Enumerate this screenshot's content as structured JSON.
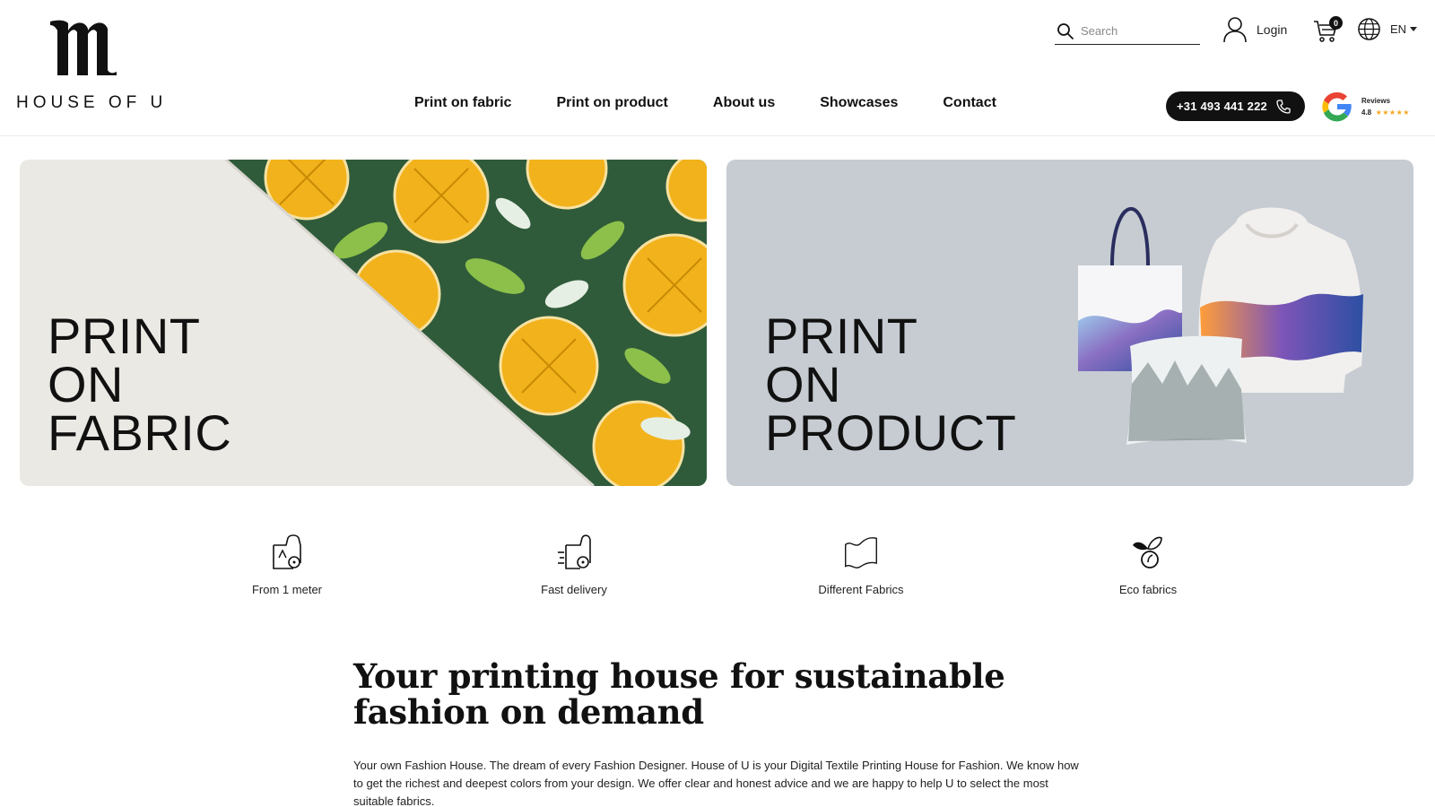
{
  "brand": {
    "name": "HOUSE OF U"
  },
  "header": {
    "search_placeholder": "Search",
    "login_label": "Login",
    "cart_count": "0",
    "language": "EN",
    "phone": "+31 493 441 222",
    "reviews": {
      "label": "Reviews",
      "score": "4.8",
      "stars": "★★★★★"
    }
  },
  "nav": {
    "items": [
      {
        "label": "Print on fabric"
      },
      {
        "label": "Print on product"
      },
      {
        "label": "About us"
      },
      {
        "label": "Showcases"
      },
      {
        "label": "Contact"
      }
    ]
  },
  "hero": {
    "fabric": {
      "lines": [
        "PRINT",
        "ON",
        "FABRIC"
      ]
    },
    "product": {
      "lines": [
        "PRINT",
        "ON",
        "PRODUCT"
      ]
    }
  },
  "features": [
    {
      "label": "From 1 meter",
      "icon": "fabric-roll-icon"
    },
    {
      "label": "Fast delivery",
      "icon": "fast-delivery-icon"
    },
    {
      "label": "Different Fabrics",
      "icon": "fabric-swatch-icon"
    },
    {
      "label": "Eco fabrics",
      "icon": "eco-leaf-icon"
    }
  ],
  "intro": {
    "title": "Your printing house for sustainable fashion on demand",
    "text": "Your own Fashion House. The dream of every Fashion Designer. House of U is your Digital Textile Printing House for Fashion. We know how to get the richest and deepest colors from your design. We offer clear and honest advice and we are happy to help U to select the most suitable fabrics."
  },
  "colors": {
    "accent": "#111111",
    "fabric_card_bg": "#ebe9e4",
    "product_card_bg": "#c6ccd2",
    "star": "#f5a623"
  }
}
